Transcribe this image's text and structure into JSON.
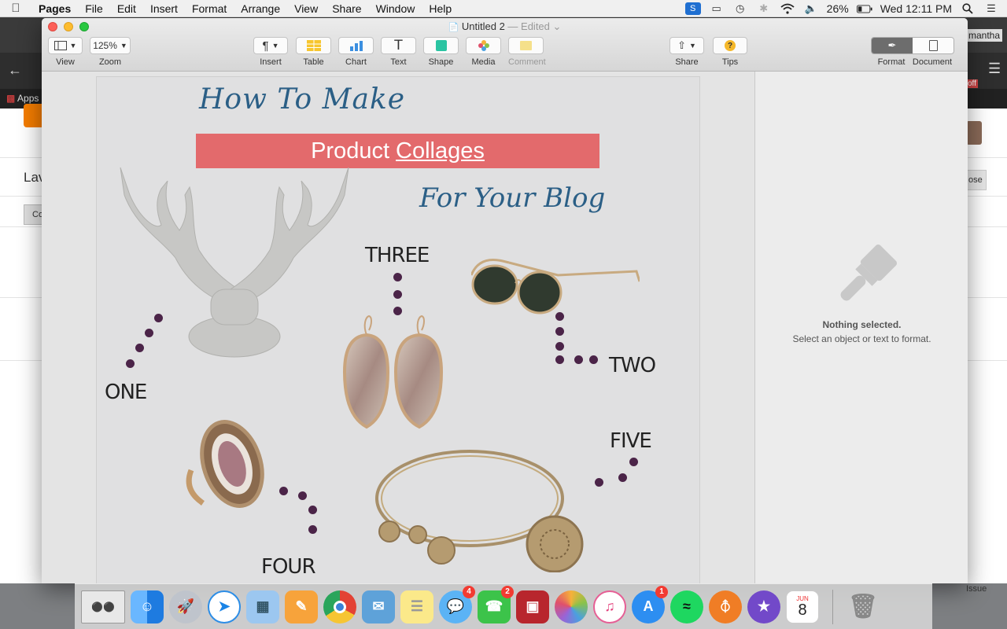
{
  "menubar": {
    "app": "Pages",
    "items": [
      "File",
      "Edit",
      "Insert",
      "Format",
      "Arrange",
      "View",
      "Share",
      "Window",
      "Help"
    ],
    "status": {
      "battery": "26%",
      "clock": "Wed 12:11 PM"
    }
  },
  "browser_bg": {
    "apps_label": "Apps",
    "user_label": "mantha",
    "off_badge": "off",
    "left_text": "Lav",
    "left_button": "Co",
    "right_button": "ose",
    "bottom_right": "Issue"
  },
  "window": {
    "title": "Untitled 2",
    "title_status": "— Edited",
    "toolbar": {
      "view": "View",
      "zoom_value": "125%",
      "zoom": "Zoom",
      "insert": "Insert",
      "table": "Table",
      "chart": "Chart",
      "text": "Text",
      "shape": "Shape",
      "media": "Media",
      "comment": "Comment",
      "share": "Share",
      "tips": "Tips",
      "format": "Format",
      "document": "Document"
    }
  },
  "document": {
    "heading_1": "How To Make",
    "banner_part_1": "Product",
    "banner_part_2": "Collages",
    "heading_2": "For Your Blog",
    "labels": {
      "one": "ONE",
      "two": "TWO",
      "three": "THREE",
      "four": "FOUR",
      "five": "FIVE"
    },
    "products": [
      "antlers",
      "earrings",
      "sunglasses",
      "ring",
      "bracelet"
    ],
    "dot_color": "#4b2448",
    "banner_color": "#e36a6c",
    "heading_color": "#2b5f86"
  },
  "inspector": {
    "title": "Nothing selected.",
    "subtitle": "Select an object or text to format."
  },
  "dock": {
    "apps": [
      "Preview",
      "Finder",
      "Launchpad",
      "Safari",
      "Preview",
      "Pages",
      "Chrome",
      "Mail",
      "Notes",
      "Messages",
      "FaceTime",
      "Photo Booth",
      "Photos",
      "iTunes",
      "App Store",
      "Spotify",
      "RSS",
      "iMovie",
      "Calendar",
      "Trash"
    ],
    "badges": {
      "messages": "4",
      "facetime": "2",
      "app_store": "1"
    },
    "calendar": {
      "month": "JUN",
      "day": "8"
    }
  }
}
